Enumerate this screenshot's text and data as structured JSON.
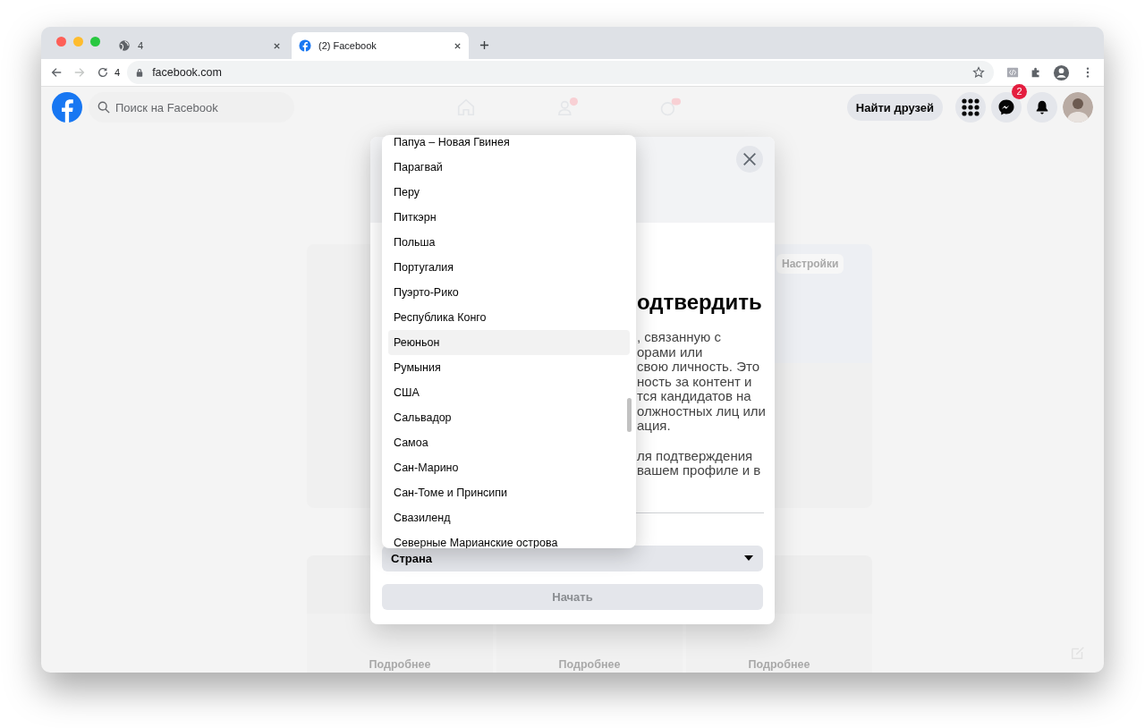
{
  "browser": {
    "tabs": [
      {
        "title": "4",
        "kind": "globe",
        "selected": false
      },
      {
        "title": "(2) Facebook",
        "kind": "facebook",
        "selected": true
      }
    ],
    "toolbar": {
      "counter": "4",
      "url": "facebook.com",
      "forward_disabled": true
    }
  },
  "header": {
    "search": {
      "placeholder": "Поиск на Facebook"
    },
    "find_friends": "Найти друзей",
    "messenger_badge": "2"
  },
  "background": {
    "settings_badge": "Настройки",
    "more_links": [
      "Подробнее",
      "Подробнее",
      "Подробнее"
    ]
  },
  "modal": {
    "heading": "одтвердить",
    "paragraphs": [
      [
        ", связанную с",
        "орами или",
        "свою личность. Это",
        "ность за контент и",
        "тся кандидатов на",
        "олжностных лиц или",
        "ация."
      ],
      [
        "ля подтверждения",
        "вашем профиле и в"
      ]
    ],
    "country_select": {
      "placeholder": "Страна"
    },
    "start_button": {
      "label": "Начать",
      "disabled": true
    }
  },
  "dropdown": {
    "options": [
      {
        "label": "Папуа – Новая Гвинея",
        "selected": false
      },
      {
        "label": "Парагвай",
        "selected": false
      },
      {
        "label": "Перу",
        "selected": false
      },
      {
        "label": "Питкэрн",
        "selected": false
      },
      {
        "label": "Польша",
        "selected": false
      },
      {
        "label": "Португалия",
        "selected": false
      },
      {
        "label": "Пуэрто-Рико",
        "selected": false
      },
      {
        "label": "Республика Конго",
        "selected": false
      },
      {
        "label": "Реюньон",
        "selected": true
      },
      {
        "label": "Румыния",
        "selected": false
      },
      {
        "label": "США",
        "selected": false
      },
      {
        "label": "Сальвадор",
        "selected": false
      },
      {
        "label": "Самоа",
        "selected": false
      },
      {
        "label": "Сан-Марино",
        "selected": false
      },
      {
        "label": "Сан-Томе и Принсипи",
        "selected": false
      },
      {
        "label": "Свазиленд",
        "selected": false
      },
      {
        "label": "Северные Марианские острова",
        "selected": false
      }
    ]
  }
}
